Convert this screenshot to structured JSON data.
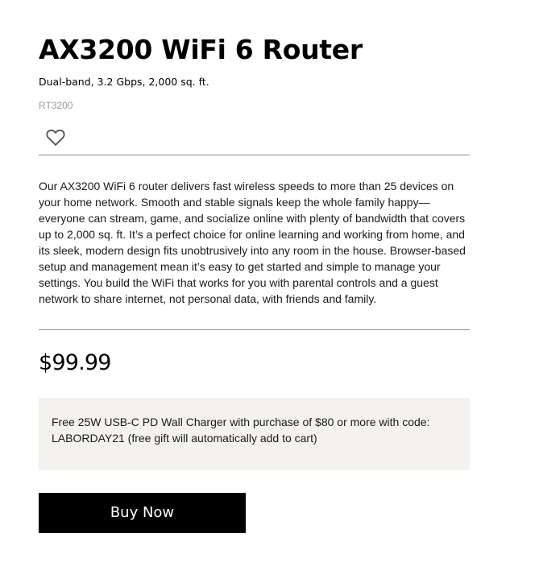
{
  "product": {
    "title": "AX3200 WiFi 6 Router",
    "subtitle": "Dual-band, 3.2 Gbps, 2,000 sq. ft.",
    "sku": "RT3200",
    "wishlist_icon": "heart-outline-icon",
    "description": "Our AX3200 WiFi 6 router delivers fast wireless speeds to more than 25 devices on your home network. Smooth and stable signals keep the whole family happy—everyone can stream, game, and socialize online with plenty of bandwidth that covers up to 2,000 sq. ft. It’s a perfect choice for online learning and working from home, and its sleek, modern design fits unobtrusively into any room in the house. Browser-based setup and management mean it’s easy to get started and simple to manage your settings. You build the WiFi that works for you with parental controls and a guest network to share internet, not personal data, with friends and family.",
    "price": "$99.99",
    "promo": "Free 25W USB-C PD Wall Charger with purchase of $80 or more with code: LABORDAY21 (free gift will automatically add to cart)",
    "buy_label": "Buy Now"
  },
  "colors": {
    "promo_background": "#f4f2ee",
    "button_background": "#000000",
    "button_text": "#ffffff",
    "sku_text": "#9a9a9a",
    "divider": "#8c8c8c"
  }
}
